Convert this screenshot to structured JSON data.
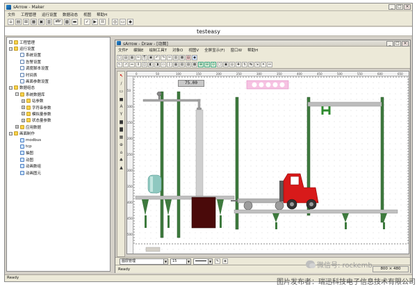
{
  "app": {
    "title": "sArrow - Maker",
    "menu": [
      "文件",
      "工程管理",
      "运行设置",
      "数据动态",
      "视图",
      "帮助H"
    ],
    "window_controls": [
      "_",
      "□",
      "×"
    ],
    "toolbar_glyphs": [
      "⌂",
      "▤",
      "⊞",
      "▦",
      "▣",
      "▥",
      "str",
      "▩",
      "▬",
      "✓",
      "▶",
      "II",
      "◎",
      "▭",
      "◆"
    ],
    "project_name": "testeasy",
    "status": "Ready"
  },
  "tree": {
    "items": [
      {
        "label": "工程管理",
        "level": 0,
        "expander": "−",
        "icon": "folder-icon"
      },
      {
        "label": "运行设置",
        "level": 0,
        "expander": "−",
        "icon": "folder-icon"
      },
      {
        "label": "系统设置",
        "level": 1,
        "expander": "",
        "icon": "document-icon"
      },
      {
        "label": "告警设置",
        "level": 1,
        "expander": "",
        "icon": "document-icon"
      },
      {
        "label": "调度脚本设置",
        "level": 1,
        "expander": "",
        "icon": "document-icon"
      },
      {
        "label": "时间表",
        "level": 1,
        "expander": "",
        "icon": "document-icon"
      },
      {
        "label": "画面参数设置",
        "level": 1,
        "expander": "",
        "icon": "document-icon"
      },
      {
        "label": "数据组态",
        "level": 0,
        "expander": "−",
        "icon": "folder-icon"
      },
      {
        "label": "系统数据库",
        "level": 1,
        "expander": "−",
        "icon": "folder-icon"
      },
      {
        "label": "站参数",
        "level": 2,
        "expander": "+",
        "icon": "folder-icon"
      },
      {
        "label": "字符串参数",
        "level": 2,
        "expander": "+",
        "icon": "folder-icon"
      },
      {
        "label": "模拟量参数",
        "level": 2,
        "expander": "+",
        "icon": "folder-icon"
      },
      {
        "label": "状态量参数",
        "level": 2,
        "expander": "+",
        "icon": "folder-icon"
      },
      {
        "label": "应用数据",
        "level": 1,
        "expander": "+",
        "icon": "folder-icon"
      },
      {
        "label": "画面制作",
        "level": 0,
        "expander": "−",
        "icon": "folder-icon"
      },
      {
        "label": "modbus",
        "level": 1,
        "expander": "",
        "icon": "page-icon"
      },
      {
        "label": "tcp",
        "level": 1,
        "expander": "",
        "icon": "page-icon"
      },
      {
        "label": "抽图",
        "level": 1,
        "expander": "",
        "icon": "page-icon"
      },
      {
        "label": "动图",
        "level": 1,
        "expander": "",
        "icon": "page-icon"
      },
      {
        "label": "动画数组",
        "level": 1,
        "expander": "",
        "icon": "page-icon"
      },
      {
        "label": "动画图元",
        "level": 1,
        "expander": "",
        "icon": "page-icon"
      }
    ]
  },
  "draw": {
    "title": "sArrow - Draw - [动图]",
    "menu": [
      "文件F",
      "编辑E",
      "绘制工具T",
      "对象O",
      "视图V",
      "全屏显示(F)",
      "窗口W",
      "帮助H"
    ],
    "window_controls": [
      "_",
      "□",
      "×"
    ],
    "tools_row1": [
      "□",
      "▤",
      "▦",
      "✂",
      "⎘",
      "▣",
      "↶",
      "↷",
      "✂",
      "▥",
      "▩",
      "▤",
      "◆"
    ],
    "tools_row2": [
      "↖",
      "↗",
      "⇔",
      "⇕",
      "◫",
      "◧",
      "◨",
      "▭",
      "▯",
      "▦",
      "▧",
      "▨",
      "▩",
      "⊕",
      "⊖",
      "⊙",
      "▢",
      "▣",
      "◎",
      "✚",
      "↯",
      "↹",
      "⇲",
      "✕",
      "↔"
    ],
    "palette": [
      "↖",
      "∕",
      "▭",
      "▅",
      "A",
      "Y",
      "▆",
      "▇",
      "▦",
      "⊕",
      "⌂",
      "♣",
      "▲"
    ],
    "value_display": "75.00",
    "ruler_top": [
      "0",
      "50",
      "100",
      "150",
      "200",
      "250",
      "300",
      "350",
      "400",
      "450",
      "500",
      "550",
      "600",
      "650"
    ],
    "ruler_left": [
      "50",
      "100",
      "150",
      "200",
      "250",
      "300",
      "350",
      "400",
      "450",
      "500"
    ],
    "combo_layer": "图层管理",
    "combo_width": "15",
    "status": "Ready",
    "size": "800 × 480"
  },
  "watermark": {
    "wechat": "微信号: rockemb",
    "publisher": "图片发布者：瑞迅科技电子信息技术有限公司"
  },
  "colors": {
    "frame": "#d4d0c8",
    "post_green": "#3e7a3e",
    "forklift_red": "#d81a1a",
    "crate": "#4a0a0a",
    "tank": "#8fc8c0"
  }
}
